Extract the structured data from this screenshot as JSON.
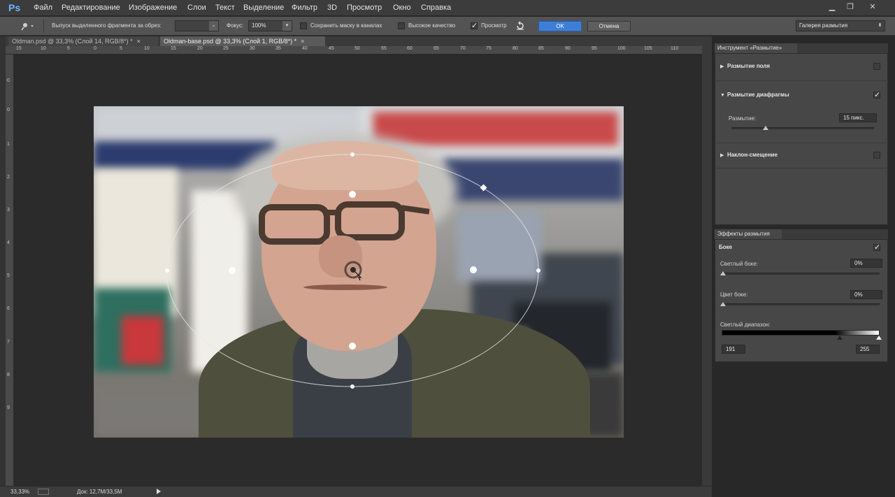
{
  "app": {
    "logo": "Ps"
  },
  "menu": [
    "Файл",
    "Редактирование",
    "Изображение",
    "Слои",
    "Текст",
    "Выделение",
    "Фильтр",
    "3D",
    "Просмотр",
    "Окно",
    "Справка"
  ],
  "options": {
    "crop_label": "Выпуск выделенного фрагмента за обрез:",
    "focus_label": "Фокус:",
    "focus_value": "100%",
    "save_mask_label": "Сохранить маску в каналах",
    "save_mask_checked": false,
    "high_quality_label": "Высокое качество",
    "high_quality_checked": false,
    "preview_label": "Просмотр",
    "preview_checked": true,
    "ok": "OK",
    "cancel": "Отмена",
    "workspace": "Галерея размытия"
  },
  "tabs": [
    {
      "label": "Oldman.psd @ 33,3% (Слой 14, RGB/8*) *",
      "close": "×",
      "active": false
    },
    {
      "label": "Oldman-base.psd @ 33,3% (Слой 1, RGB/8*) *",
      "close": "×",
      "active": true
    }
  ],
  "ruler": {
    "h": [
      "15",
      "10",
      "5",
      "0",
      "5",
      "10",
      "15",
      "20",
      "25",
      "30",
      "35",
      "40",
      "45",
      "50",
      "55",
      "60",
      "65",
      "70",
      "75",
      "80",
      "85",
      "90",
      "95",
      "100",
      "105",
      "110"
    ],
    "v": [
      "0",
      "0",
      "1",
      "2",
      "3",
      "4",
      "5",
      "6",
      "7",
      "8",
      "9"
    ]
  },
  "status": {
    "zoom": "33,33%",
    "doc": "Док: 12,7M/33,5M"
  },
  "blur_tools": {
    "tab": "Инструмент «Размытие»",
    "field_blur": {
      "label": "Размытие поля",
      "checked": false
    },
    "iris_blur": {
      "label": "Размытие диафрагмы",
      "checked": true,
      "blur_label": "Размытие:",
      "blur_value": "15 пикс.",
      "blur_level": 0.24
    },
    "tilt_shift": {
      "label": "Наклон-смещение",
      "checked": false
    }
  },
  "blur_effects": {
    "tab": "Эффекты размытия",
    "bokeh": {
      "label": "Боке",
      "checked": true
    },
    "light_bokeh": {
      "label": "Светлый боке:",
      "value": "0%"
    },
    "bokeh_color": {
      "label": "Цвет боке:",
      "value": "0%"
    },
    "light_range": {
      "label": "Светлый диапазон:",
      "low": "191",
      "high": "255"
    }
  },
  "colors": {
    "accent": "#3d7fd8",
    "panel": "#474747",
    "bg": "#282828"
  }
}
